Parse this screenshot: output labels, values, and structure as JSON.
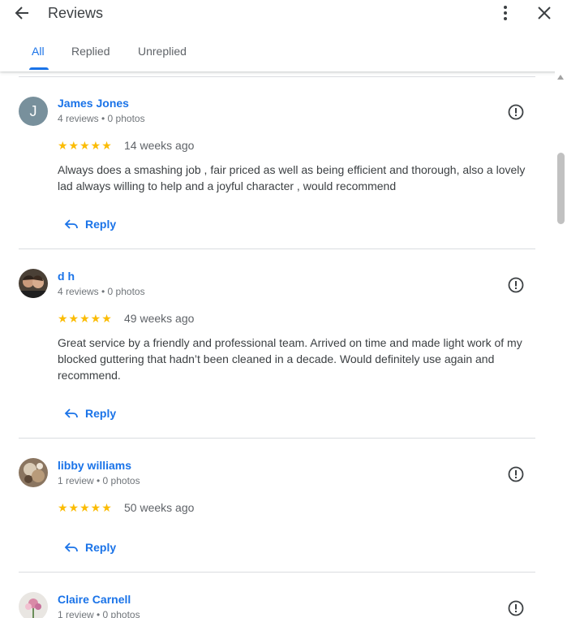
{
  "header": {
    "title": "Reviews",
    "back_icon": "arrow-back-icon",
    "more_icon": "more-vert-icon",
    "close_icon": "close-icon"
  },
  "tabs": [
    {
      "label": "All",
      "active": true
    },
    {
      "label": "Replied",
      "active": false
    },
    {
      "label": "Unreplied",
      "active": false
    }
  ],
  "reviews": [
    {
      "name": "James Jones",
      "avatar_letter": "J",
      "meta": "4 reviews • 0 photos",
      "stars": "★★★★★",
      "rating": 5,
      "time": "14 weeks ago",
      "text": "Always does a smashing job , fair priced as well as being efficient and thorough, also a lovely lad always willing to help and a joyful character , would recommend",
      "reply_label": "Reply"
    },
    {
      "name": "d h",
      "meta": "4 reviews • 0 photos",
      "stars": "★★★★★",
      "rating": 5,
      "time": "49 weeks ago",
      "text": "Great service by a friendly and professional team. Arrived on time and made light work of my blocked guttering that hadn’t been cleaned in a decade. Would definitely use again and recommend.",
      "reply_label": "Reply"
    },
    {
      "name": "libby williams",
      "meta": "1 review • 0 photos",
      "stars": "★★★★★",
      "rating": 5,
      "time": "50 weeks ago",
      "text": "",
      "reply_label": "Reply"
    },
    {
      "name": "Claire Carnell",
      "meta": "1 review • 0 photos"
    }
  ],
  "colors": {
    "accent": "#1a73e8",
    "star": "#fbbc04",
    "text": "#3c4043",
    "secondary": "#70757a",
    "divider": "#dadce0"
  }
}
